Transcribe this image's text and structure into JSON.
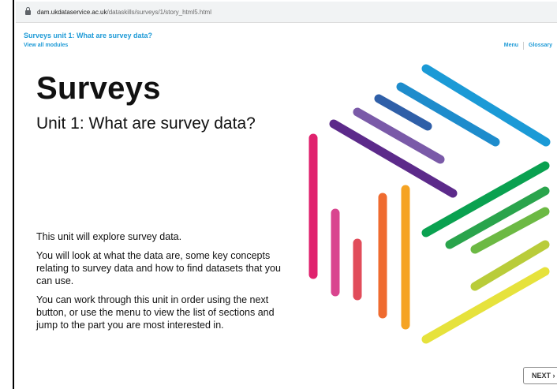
{
  "browser": {
    "url_host": "dam.ukdataservice.ac.uk",
    "url_path": "/dataskills/surveys/1/story_html5.html"
  },
  "header": {
    "course_title": "Surveys unit 1: What are survey data?",
    "view_all": "View all modules",
    "nav": [
      "Menu",
      "Glossary"
    ]
  },
  "main": {
    "title": "Surveys",
    "subtitle": "Unit 1: What are survey data?",
    "paragraphs": [
      "This unit will explore survey data.",
      "You will look at what the data are, some key concepts relating to survey data and how to find datasets that you can use.",
      "You can work through this unit in order using the next button, or use the menu to view the list of sections and jump to the part you are most interested in."
    ]
  },
  "footer": {
    "next_label": "NEXT ›"
  },
  "colors": {
    "accent": "#1f9bd7",
    "stripes": [
      "#1b9ad6",
      "#2a67b0",
      "#2f5fa8",
      "#7a5aa8",
      "#5c2a8a",
      "#e0226e",
      "#d9458f",
      "#e14c5a",
      "#ef6b2f",
      "#f5a323",
      "#0aa150",
      "#2aa44c",
      "#6cb944",
      "#b9cc3a",
      "#e6e23c"
    ]
  }
}
